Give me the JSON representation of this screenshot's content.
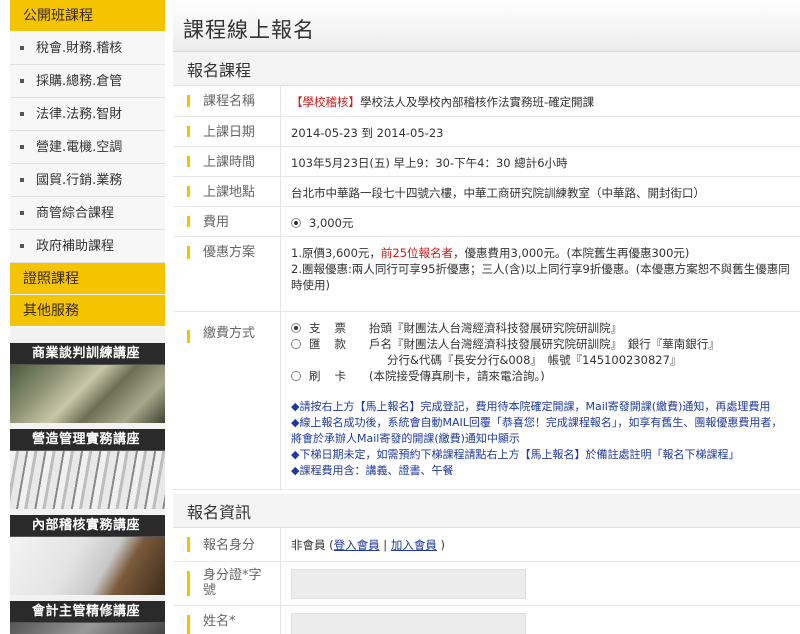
{
  "sidebar": {
    "categories": [
      {
        "label": "公開班課程",
        "items": [
          "稅會.財務.稽核",
          "採購.總務.倉管",
          "法律.法務.智財",
          "營建.電機.空調",
          "國貿.行銷.業務",
          "商管綜合課程",
          "政府補助課程"
        ]
      },
      {
        "label": "證照課程"
      },
      {
        "label": "其他服務"
      }
    ],
    "banners": [
      "商業談判訓練講座",
      "營造管理實務講座",
      "內部稽核實務講座",
      "會計主管精修講座"
    ]
  },
  "page": {
    "title": "課程線上報名"
  },
  "course": {
    "section_title": "報名課程",
    "fields": {
      "name": {
        "label": "課程名稱",
        "tag": "【學校稽核】",
        "value": "學校法人及學校內部稽核作法實務班-確定開課"
      },
      "date": {
        "label": "上課日期",
        "value": "2014-05-23 到 2014-05-23"
      },
      "time": {
        "label": "上課時間",
        "value": "103年5月23日(五) 早上9：30-下午4：30 總計6小時"
      },
      "location": {
        "label": "上課地點",
        "value": "台北市中華路一段七十四號六樓，中華工商研究院訓練教室（中華路、開封街口）"
      },
      "fee": {
        "label": "費用",
        "value": "3,000元"
      },
      "discount": {
        "label": "優惠方案",
        "line1_pre": "1.原價3,600元，",
        "line1_red": "前25位報名者",
        "line1_post": "，優惠費用3,000元。(本院舊生再優惠300元)",
        "line2": "2.團報優惠:兩人同行可享95折優惠；三人(含)以上同行享9折優惠。(本優惠方案恕不與舊生優惠同時使用)"
      },
      "payment": {
        "label": "繳費方式",
        "check": {
          "method": "支票",
          "detail": "抬頭『財團法人台灣經濟科技發展研究院研訓院』"
        },
        "remit": {
          "method": "匯款",
          "detail": "戶名『財團法人台灣經濟科技發展研究院研訓院』　銀行『華南銀行』",
          "detail2": "分行&代碼『長安分行&008』　帳號『145100230827』"
        },
        "card": {
          "method": "刷卡",
          "detail": "(本院接受傳真刷卡，請來電洽詢。)"
        },
        "notes": [
          "◆請按右上方【馬上報名】完成登記，費用待本院確定開課，Mail寄發開課(繳費)通知，再處理費用",
          "◆線上報名成功後，系統會自動MAIL回覆「恭喜您！完成課程報名」，如享有舊生、團報優惠費用者，將會於承辦人Mail寄發的開課(繳費)通知中顯示",
          "◆下梯日期未定，如需預約下梯課程請點右上方【馬上報名】於備註處註明「報名下梯課程」",
          "◆課程費用含：講義、證書、午餐"
        ]
      }
    }
  },
  "registration": {
    "section_title": "報名資訊",
    "identity": {
      "label": "報名身分",
      "prefix": "非會員 (",
      "login": "登入會員",
      "sep": " | ",
      "join": "加入會員",
      "suffix": " )"
    },
    "id_number": {
      "label": "身分證*字號"
    },
    "name": {
      "label": "姓名*"
    }
  }
}
